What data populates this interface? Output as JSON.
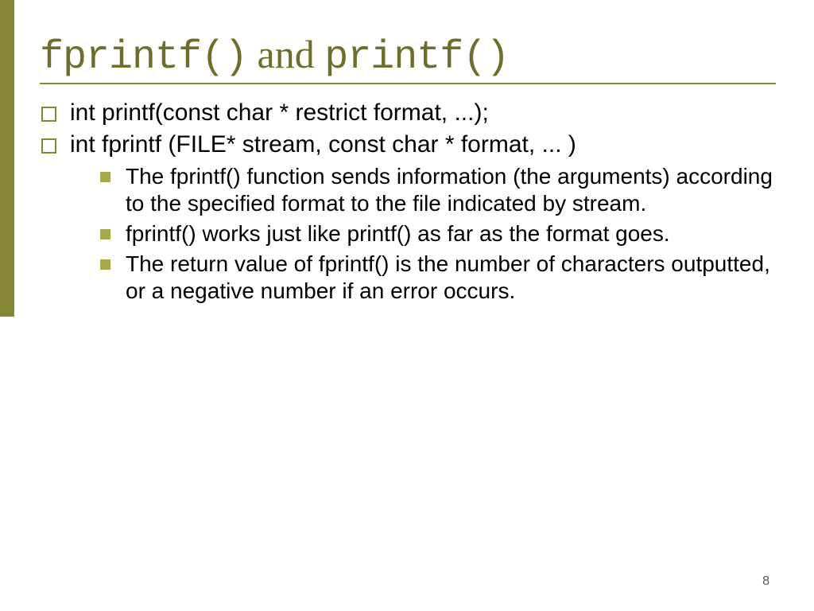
{
  "title": {
    "part1_mono": "fprintf()",
    "joiner": " and ",
    "part2_mono": "printf()"
  },
  "bullets": {
    "b1": "int printf(const char * restrict format, ...);",
    "b2": "int fprintf (FILE* stream, const char * format, ... )",
    "sub": {
      "s1": "The fprintf() function sends information (the arguments) according to the specified format to the file indicated by stream.",
      "s2": "fprintf() works just like printf() as far as the format goes.",
      "s3": "The return value of fprintf() is the number of characters outputted, or a  negative number if an error occurs."
    }
  },
  "page_number": "8"
}
